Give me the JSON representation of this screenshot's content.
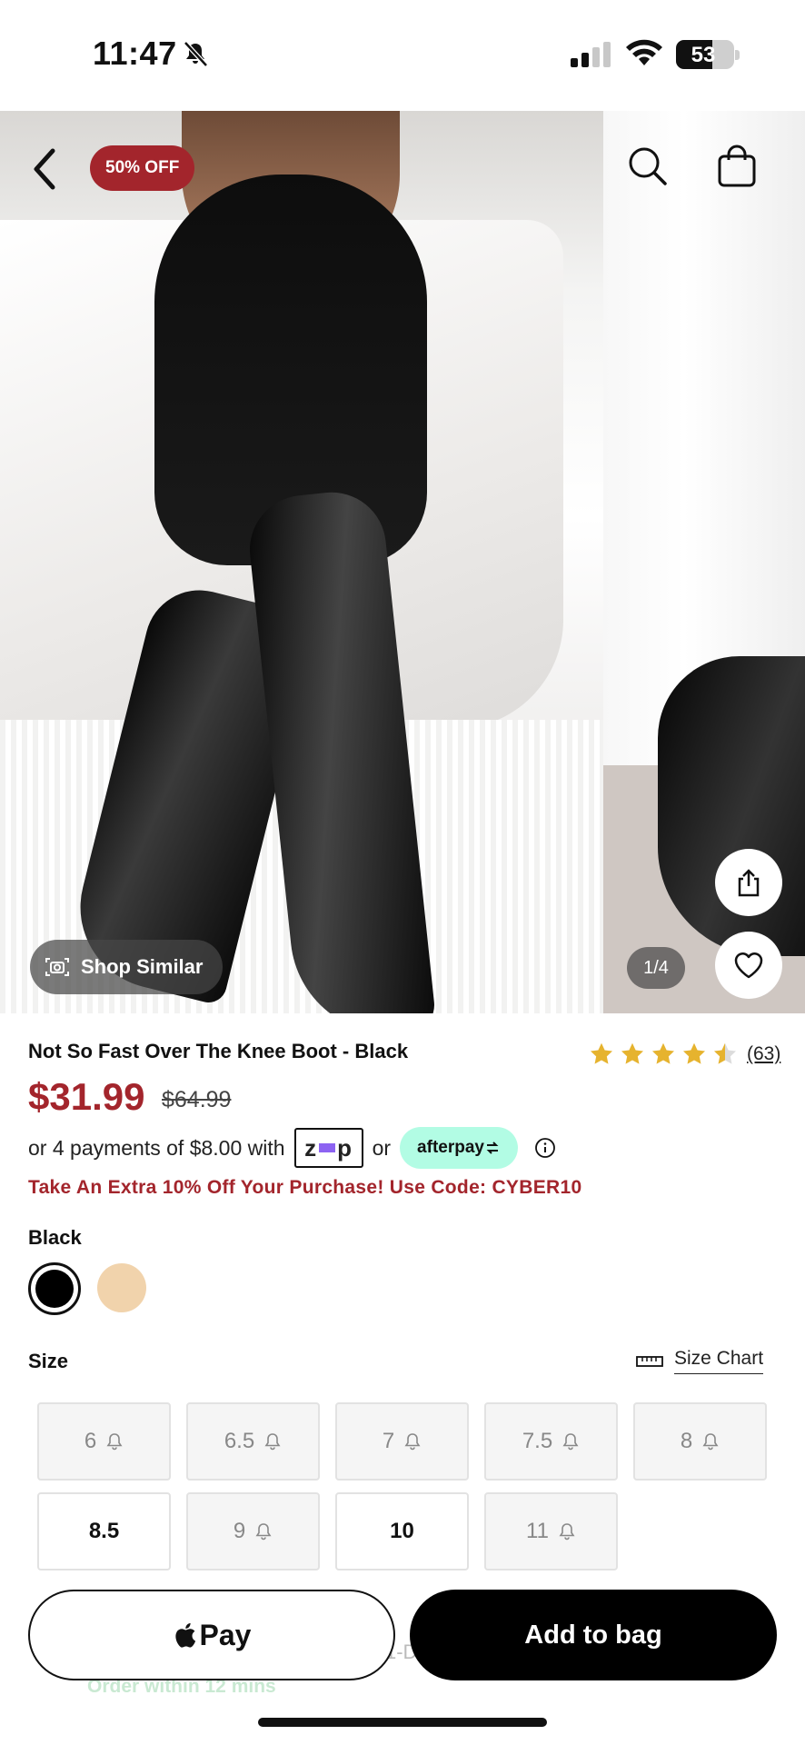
{
  "status_bar": {
    "time": "11:47",
    "battery": "53"
  },
  "gallery": {
    "discount_badge": "50% OFF",
    "shop_similar": "Shop Similar",
    "pager": "1/4"
  },
  "product": {
    "title": "Not So Fast Over The Knee Boot - Black",
    "rating_stars": 4.5,
    "rating_count": "(63)",
    "price_sale": "$31.99",
    "price_original": "$64.99",
    "installments_text": "or 4 payments of $8.00 with",
    "zip_label": "zip",
    "or_text": "or",
    "afterpay_label": "afterpay",
    "promo": "Take An Extra 10% Off Your Purchase! Use Code: CYBER10"
  },
  "color": {
    "selected_label": "Black",
    "swatches": [
      {
        "name": "Black",
        "hex": "#000000",
        "selected": true
      },
      {
        "name": "Nude",
        "hex": "#f1d3ac",
        "selected": false
      }
    ]
  },
  "size": {
    "label": "Size",
    "chart_link": "Size Chart",
    "options": [
      {
        "label": "6",
        "available": false
      },
      {
        "label": "6.5",
        "available": false
      },
      {
        "label": "7",
        "available": false
      },
      {
        "label": "7.5",
        "available": false
      },
      {
        "label": "8",
        "available": false
      },
      {
        "label": "8.5",
        "available": true
      },
      {
        "label": "9",
        "available": false
      },
      {
        "label": "10",
        "available": true
      },
      {
        "label": "11",
        "available": false
      }
    ]
  },
  "actions": {
    "apple_pay": "Pay",
    "add_to_bag": "Add to bag",
    "delivery_partial": "1-D",
    "delivery_hint": "Order within 12 mins"
  },
  "colors": {
    "accent": "#a3252c",
    "afterpay": "#b2fce4",
    "zip_purple": "#8d63f2"
  }
}
